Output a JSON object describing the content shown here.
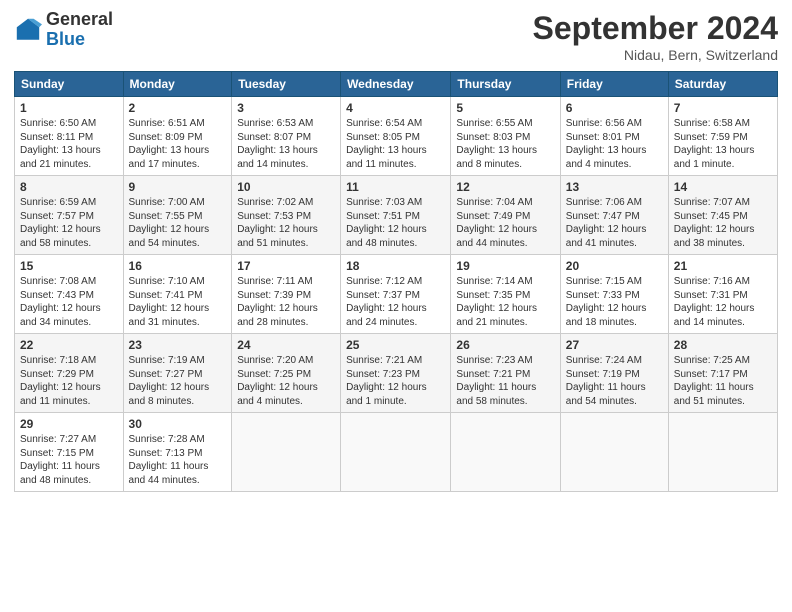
{
  "header": {
    "logo_general": "General",
    "logo_blue": "Blue",
    "month_title": "September 2024",
    "location": "Nidau, Bern, Switzerland"
  },
  "columns": [
    "Sunday",
    "Monday",
    "Tuesday",
    "Wednesday",
    "Thursday",
    "Friday",
    "Saturday"
  ],
  "weeks": [
    [
      {
        "day": "1",
        "info": "Sunrise: 6:50 AM\nSunset: 8:11 PM\nDaylight: 13 hours\nand 21 minutes."
      },
      {
        "day": "2",
        "info": "Sunrise: 6:51 AM\nSunset: 8:09 PM\nDaylight: 13 hours\nand 17 minutes."
      },
      {
        "day": "3",
        "info": "Sunrise: 6:53 AM\nSunset: 8:07 PM\nDaylight: 13 hours\nand 14 minutes."
      },
      {
        "day": "4",
        "info": "Sunrise: 6:54 AM\nSunset: 8:05 PM\nDaylight: 13 hours\nand 11 minutes."
      },
      {
        "day": "5",
        "info": "Sunrise: 6:55 AM\nSunset: 8:03 PM\nDaylight: 13 hours\nand 8 minutes."
      },
      {
        "day": "6",
        "info": "Sunrise: 6:56 AM\nSunset: 8:01 PM\nDaylight: 13 hours\nand 4 minutes."
      },
      {
        "day": "7",
        "info": "Sunrise: 6:58 AM\nSunset: 7:59 PM\nDaylight: 13 hours\nand 1 minute."
      }
    ],
    [
      {
        "day": "8",
        "info": "Sunrise: 6:59 AM\nSunset: 7:57 PM\nDaylight: 12 hours\nand 58 minutes."
      },
      {
        "day": "9",
        "info": "Sunrise: 7:00 AM\nSunset: 7:55 PM\nDaylight: 12 hours\nand 54 minutes."
      },
      {
        "day": "10",
        "info": "Sunrise: 7:02 AM\nSunset: 7:53 PM\nDaylight: 12 hours\nand 51 minutes."
      },
      {
        "day": "11",
        "info": "Sunrise: 7:03 AM\nSunset: 7:51 PM\nDaylight: 12 hours\nand 48 minutes."
      },
      {
        "day": "12",
        "info": "Sunrise: 7:04 AM\nSunset: 7:49 PM\nDaylight: 12 hours\nand 44 minutes."
      },
      {
        "day": "13",
        "info": "Sunrise: 7:06 AM\nSunset: 7:47 PM\nDaylight: 12 hours\nand 41 minutes."
      },
      {
        "day": "14",
        "info": "Sunrise: 7:07 AM\nSunset: 7:45 PM\nDaylight: 12 hours\nand 38 minutes."
      }
    ],
    [
      {
        "day": "15",
        "info": "Sunrise: 7:08 AM\nSunset: 7:43 PM\nDaylight: 12 hours\nand 34 minutes."
      },
      {
        "day": "16",
        "info": "Sunrise: 7:10 AM\nSunset: 7:41 PM\nDaylight: 12 hours\nand 31 minutes."
      },
      {
        "day": "17",
        "info": "Sunrise: 7:11 AM\nSunset: 7:39 PM\nDaylight: 12 hours\nand 28 minutes."
      },
      {
        "day": "18",
        "info": "Sunrise: 7:12 AM\nSunset: 7:37 PM\nDaylight: 12 hours\nand 24 minutes."
      },
      {
        "day": "19",
        "info": "Sunrise: 7:14 AM\nSunset: 7:35 PM\nDaylight: 12 hours\nand 21 minutes."
      },
      {
        "day": "20",
        "info": "Sunrise: 7:15 AM\nSunset: 7:33 PM\nDaylight: 12 hours\nand 18 minutes."
      },
      {
        "day": "21",
        "info": "Sunrise: 7:16 AM\nSunset: 7:31 PM\nDaylight: 12 hours\nand 14 minutes."
      }
    ],
    [
      {
        "day": "22",
        "info": "Sunrise: 7:18 AM\nSunset: 7:29 PM\nDaylight: 12 hours\nand 11 minutes."
      },
      {
        "day": "23",
        "info": "Sunrise: 7:19 AM\nSunset: 7:27 PM\nDaylight: 12 hours\nand 8 minutes."
      },
      {
        "day": "24",
        "info": "Sunrise: 7:20 AM\nSunset: 7:25 PM\nDaylight: 12 hours\nand 4 minutes."
      },
      {
        "day": "25",
        "info": "Sunrise: 7:21 AM\nSunset: 7:23 PM\nDaylight: 12 hours\nand 1 minute."
      },
      {
        "day": "26",
        "info": "Sunrise: 7:23 AM\nSunset: 7:21 PM\nDaylight: 11 hours\nand 58 minutes."
      },
      {
        "day": "27",
        "info": "Sunrise: 7:24 AM\nSunset: 7:19 PM\nDaylight: 11 hours\nand 54 minutes."
      },
      {
        "day": "28",
        "info": "Sunrise: 7:25 AM\nSunset: 7:17 PM\nDaylight: 11 hours\nand 51 minutes."
      }
    ],
    [
      {
        "day": "29",
        "info": "Sunrise: 7:27 AM\nSunset: 7:15 PM\nDaylight: 11 hours\nand 48 minutes."
      },
      {
        "day": "30",
        "info": "Sunrise: 7:28 AM\nSunset: 7:13 PM\nDaylight: 11 hours\nand 44 minutes."
      },
      {
        "day": "",
        "info": ""
      },
      {
        "day": "",
        "info": ""
      },
      {
        "day": "",
        "info": ""
      },
      {
        "day": "",
        "info": ""
      },
      {
        "day": "",
        "info": ""
      }
    ]
  ]
}
